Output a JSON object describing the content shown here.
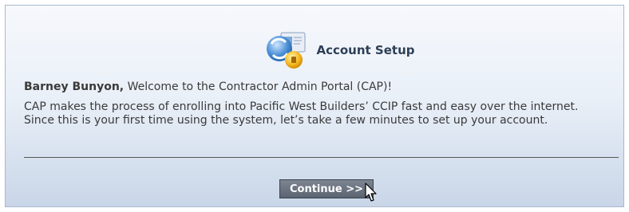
{
  "header": {
    "title": "Account Setup",
    "icon": "account-setup-icon"
  },
  "welcome": {
    "name": "Barney Bunyon,",
    "message": " Welcome to the Contractor Admin Portal (CAP)!"
  },
  "description": "CAP makes the process of enrolling into Pacific West Builders’ CCIP fast and easy over the internet. Since this is your first time using the system, let’s take a few minutes to set up your account.",
  "continue_button": {
    "label": "Continue >>"
  },
  "colors": {
    "panel_top": "#f6f8fc",
    "panel_bottom": "#c9d6e8",
    "button": "#5b6471",
    "title": "#2e3f56"
  }
}
